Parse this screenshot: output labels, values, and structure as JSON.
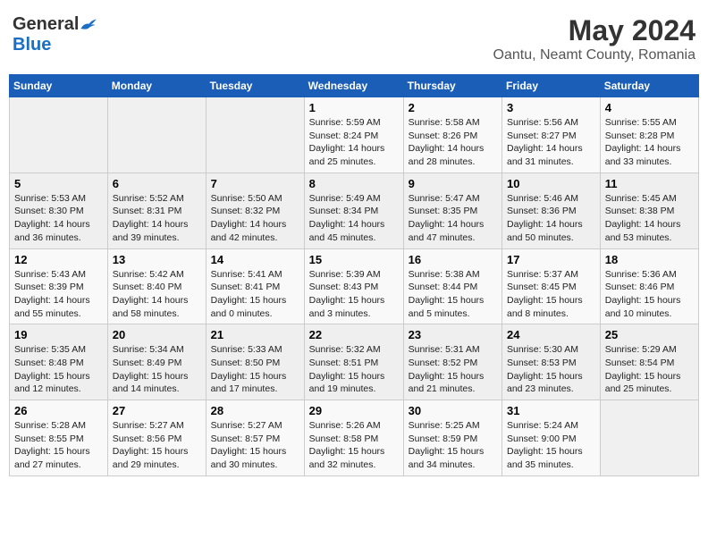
{
  "header": {
    "logo_general": "General",
    "logo_blue": "Blue",
    "title": "May 2024",
    "subtitle": "Oantu, Neamt County, Romania"
  },
  "days_of_week": [
    "Sunday",
    "Monday",
    "Tuesday",
    "Wednesday",
    "Thursday",
    "Friday",
    "Saturday"
  ],
  "weeks": [
    [
      {
        "day": "",
        "info": ""
      },
      {
        "day": "",
        "info": ""
      },
      {
        "day": "",
        "info": ""
      },
      {
        "day": "1",
        "info": "Sunrise: 5:59 AM\nSunset: 8:24 PM\nDaylight: 14 hours\nand 25 minutes."
      },
      {
        "day": "2",
        "info": "Sunrise: 5:58 AM\nSunset: 8:26 PM\nDaylight: 14 hours\nand 28 minutes."
      },
      {
        "day": "3",
        "info": "Sunrise: 5:56 AM\nSunset: 8:27 PM\nDaylight: 14 hours\nand 31 minutes."
      },
      {
        "day": "4",
        "info": "Sunrise: 5:55 AM\nSunset: 8:28 PM\nDaylight: 14 hours\nand 33 minutes."
      }
    ],
    [
      {
        "day": "5",
        "info": "Sunrise: 5:53 AM\nSunset: 8:30 PM\nDaylight: 14 hours\nand 36 minutes."
      },
      {
        "day": "6",
        "info": "Sunrise: 5:52 AM\nSunset: 8:31 PM\nDaylight: 14 hours\nand 39 minutes."
      },
      {
        "day": "7",
        "info": "Sunrise: 5:50 AM\nSunset: 8:32 PM\nDaylight: 14 hours\nand 42 minutes."
      },
      {
        "day": "8",
        "info": "Sunrise: 5:49 AM\nSunset: 8:34 PM\nDaylight: 14 hours\nand 45 minutes."
      },
      {
        "day": "9",
        "info": "Sunrise: 5:47 AM\nSunset: 8:35 PM\nDaylight: 14 hours\nand 47 minutes."
      },
      {
        "day": "10",
        "info": "Sunrise: 5:46 AM\nSunset: 8:36 PM\nDaylight: 14 hours\nand 50 minutes."
      },
      {
        "day": "11",
        "info": "Sunrise: 5:45 AM\nSunset: 8:38 PM\nDaylight: 14 hours\nand 53 minutes."
      }
    ],
    [
      {
        "day": "12",
        "info": "Sunrise: 5:43 AM\nSunset: 8:39 PM\nDaylight: 14 hours\nand 55 minutes."
      },
      {
        "day": "13",
        "info": "Sunrise: 5:42 AM\nSunset: 8:40 PM\nDaylight: 14 hours\nand 58 minutes."
      },
      {
        "day": "14",
        "info": "Sunrise: 5:41 AM\nSunset: 8:41 PM\nDaylight: 15 hours\nand 0 minutes."
      },
      {
        "day": "15",
        "info": "Sunrise: 5:39 AM\nSunset: 8:43 PM\nDaylight: 15 hours\nand 3 minutes."
      },
      {
        "day": "16",
        "info": "Sunrise: 5:38 AM\nSunset: 8:44 PM\nDaylight: 15 hours\nand 5 minutes."
      },
      {
        "day": "17",
        "info": "Sunrise: 5:37 AM\nSunset: 8:45 PM\nDaylight: 15 hours\nand 8 minutes."
      },
      {
        "day": "18",
        "info": "Sunrise: 5:36 AM\nSunset: 8:46 PM\nDaylight: 15 hours\nand 10 minutes."
      }
    ],
    [
      {
        "day": "19",
        "info": "Sunrise: 5:35 AM\nSunset: 8:48 PM\nDaylight: 15 hours\nand 12 minutes."
      },
      {
        "day": "20",
        "info": "Sunrise: 5:34 AM\nSunset: 8:49 PM\nDaylight: 15 hours\nand 14 minutes."
      },
      {
        "day": "21",
        "info": "Sunrise: 5:33 AM\nSunset: 8:50 PM\nDaylight: 15 hours\nand 17 minutes."
      },
      {
        "day": "22",
        "info": "Sunrise: 5:32 AM\nSunset: 8:51 PM\nDaylight: 15 hours\nand 19 minutes."
      },
      {
        "day": "23",
        "info": "Sunrise: 5:31 AM\nSunset: 8:52 PM\nDaylight: 15 hours\nand 21 minutes."
      },
      {
        "day": "24",
        "info": "Sunrise: 5:30 AM\nSunset: 8:53 PM\nDaylight: 15 hours\nand 23 minutes."
      },
      {
        "day": "25",
        "info": "Sunrise: 5:29 AM\nSunset: 8:54 PM\nDaylight: 15 hours\nand 25 minutes."
      }
    ],
    [
      {
        "day": "26",
        "info": "Sunrise: 5:28 AM\nSunset: 8:55 PM\nDaylight: 15 hours\nand 27 minutes."
      },
      {
        "day": "27",
        "info": "Sunrise: 5:27 AM\nSunset: 8:56 PM\nDaylight: 15 hours\nand 29 minutes."
      },
      {
        "day": "28",
        "info": "Sunrise: 5:27 AM\nSunset: 8:57 PM\nDaylight: 15 hours\nand 30 minutes."
      },
      {
        "day": "29",
        "info": "Sunrise: 5:26 AM\nSunset: 8:58 PM\nDaylight: 15 hours\nand 32 minutes."
      },
      {
        "day": "30",
        "info": "Sunrise: 5:25 AM\nSunset: 8:59 PM\nDaylight: 15 hours\nand 34 minutes."
      },
      {
        "day": "31",
        "info": "Sunrise: 5:24 AM\nSunset: 9:00 PM\nDaylight: 15 hours\nand 35 minutes."
      },
      {
        "day": "",
        "info": ""
      }
    ]
  ]
}
